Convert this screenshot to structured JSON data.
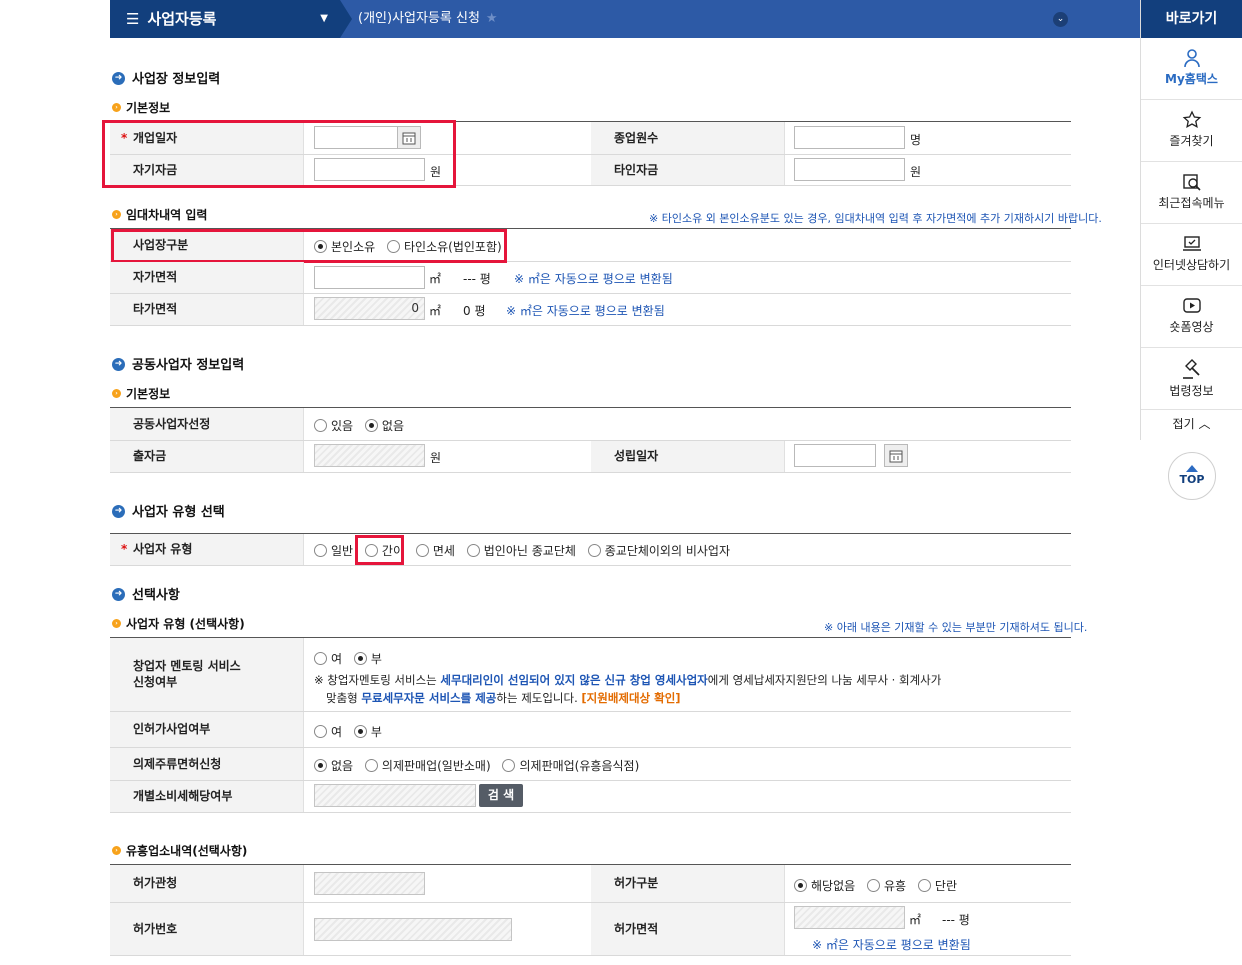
{
  "header": {
    "menu_title": "사업자등록",
    "breadcrumb": "(개인)사업자등록 신청"
  },
  "sidebar": {
    "title": "바로가기",
    "items": [
      {
        "label": "My홈택스",
        "icon": "user-icon"
      },
      {
        "label": "즐겨찾기",
        "icon": "star-icon"
      },
      {
        "label": "최근접속메뉴",
        "icon": "recent-menu-icon"
      },
      {
        "label": "인터넷상담하기",
        "icon": "laptop-icon"
      },
      {
        "label": "숏폼영상",
        "icon": "play-icon"
      },
      {
        "label": "법령정보",
        "icon": "gavel-icon"
      }
    ],
    "fold": "접기",
    "top": "TOP"
  },
  "s1": {
    "title": "사업장 정보입력",
    "basic": "기본정보",
    "open_date": "개업일자",
    "employees": "종업원수",
    "employees_unit": "명",
    "own_fund": "자기자금",
    "own_fund_unit": "원",
    "other_fund": "타인자금",
    "other_fund_unit": "원",
    "lease_title": "임대차내역 입력",
    "lease_note": "※ 타인소유 외 본인소유분도 있는 경우, 임대차내역 입력 후 자가면적에 추가 기재하시기 바랍니다.",
    "place_type": "사업장구분",
    "place_opt1": "본인소유",
    "place_opt2": "타인소유(법인포함)",
    "own_area": "자가면적",
    "own_area_unit": "㎡",
    "own_area_pyeong": "--- 평",
    "own_area_note": "※ ㎡은 자동으로 평으로 변환됨",
    "other_area": "타가면적",
    "other_area_value": "0",
    "other_area_unit": "㎡",
    "other_area_pyeong": "0 평",
    "other_area_note": "※ ㎡은 자동으로 평으로 변환됨"
  },
  "s2": {
    "title": "공동사업자 정보입력",
    "basic": "기본정보",
    "select": "공동사업자선정",
    "opt_yes": "있음",
    "opt_no": "없음",
    "invest": "출자금",
    "invest_unit": "원",
    "est_date": "성립일자"
  },
  "s3": {
    "title": "사업자 유형 선택",
    "type": "사업자 유형",
    "opts": [
      "일반",
      "간이",
      "면세",
      "법인아닌 종교단체",
      "종교단체이외의 비사업자"
    ]
  },
  "s4": {
    "title": "선택사항",
    "sub": "사업자 유형 (선택사항)",
    "note": "※ 아래 내용은 기재할 수 있는 부분만 기재하셔도 됩니다.",
    "mentor_l1": "창업자 멘토링 서비스",
    "mentor_l2": "신청여부",
    "yes": "여",
    "no": "부",
    "mentor_desc_a": "※ 창업자멘토링 서비스는 ",
    "mentor_desc_b": "세무대리인이 선임되어 있지 않은 신규 창업 영세사업자",
    "mentor_desc_c": "에게 영세납세자지원단의 나눔 세무사 · 회계사가",
    "mentor_desc_d": "맞춤형 ",
    "mentor_desc_e": "무료세무자문 서비스를 제공",
    "mentor_desc_f": "하는 제도입니다. ",
    "mentor_desc_g": "[지원배제대상 확인]",
    "license": "인허가사업여부",
    "liquor": "의제주류면허신청",
    "liquor_opts": [
      "없음",
      "의제판매업(일반소매)",
      "의제판매업(유흥음식점)"
    ],
    "excise": "개별소비세해당여부",
    "search": "검 색"
  },
  "s5": {
    "title": "유흥업소내역(선택사항)",
    "office": "허가관청",
    "kind": "허가구분",
    "kind_opts": [
      "해당없음",
      "유흥",
      "단란"
    ],
    "number": "허가번호",
    "area": "허가면적",
    "area_unit": "㎡",
    "area_pyeong": "--- 평",
    "area_note": "※ ㎡은 자동으로 평으로 변환됨"
  }
}
